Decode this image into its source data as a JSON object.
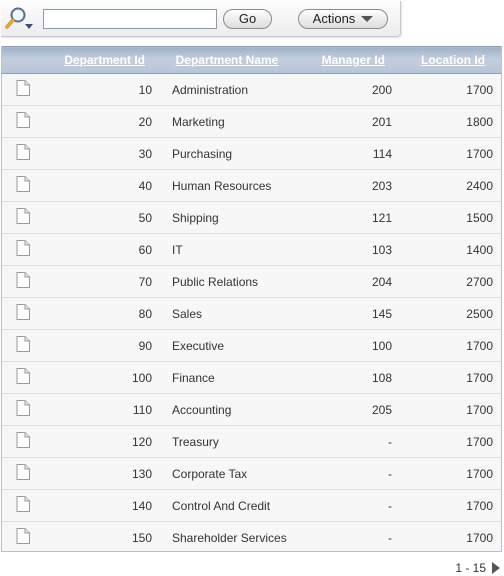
{
  "toolbar": {
    "search_value": "",
    "go_label": "Go",
    "actions_label": "Actions",
    "search_icon": "magnifier-dropdown-icon",
    "actions_icon": "caret-down-icon"
  },
  "report": {
    "columns": [
      "Department Id",
      "Department Name",
      "Manager Id",
      "Location Id"
    ],
    "row_icon": "document-icon",
    "rows": [
      {
        "id": "10",
        "name": "Administration",
        "manager": "200",
        "location": "1700"
      },
      {
        "id": "20",
        "name": "Marketing",
        "manager": "201",
        "location": "1800"
      },
      {
        "id": "30",
        "name": "Purchasing",
        "manager": "114",
        "location": "1700"
      },
      {
        "id": "40",
        "name": "Human Resources",
        "manager": "203",
        "location": "2400"
      },
      {
        "id": "50",
        "name": "Shipping",
        "manager": "121",
        "location": "1500"
      },
      {
        "id": "60",
        "name": "IT",
        "manager": "103",
        "location": "1400"
      },
      {
        "id": "70",
        "name": "Public Relations",
        "manager": "204",
        "location": "2700"
      },
      {
        "id": "80",
        "name": "Sales",
        "manager": "145",
        "location": "2500"
      },
      {
        "id": "90",
        "name": "Executive",
        "manager": "100",
        "location": "1700"
      },
      {
        "id": "100",
        "name": "Finance",
        "manager": "108",
        "location": "1700"
      },
      {
        "id": "110",
        "name": "Accounting",
        "manager": "205",
        "location": "1700"
      },
      {
        "id": "120",
        "name": "Treasury",
        "manager": "-",
        "location": "1700"
      },
      {
        "id": "130",
        "name": "Corporate Tax",
        "manager": "-",
        "location": "1700"
      },
      {
        "id": "140",
        "name": "Control And Credit",
        "manager": "-",
        "location": "1700"
      },
      {
        "id": "150",
        "name": "Shareholder Services",
        "manager": "-",
        "location": "1700"
      }
    ]
  },
  "pagination": {
    "range": "1 - 15",
    "next_icon": "next-arrow-icon"
  },
  "colors": {
    "header_bg": "#b8c5d6",
    "header_text": "#ffffff",
    "row_bg": "#f7f7f7",
    "grid_line": "#dcdcdc"
  }
}
